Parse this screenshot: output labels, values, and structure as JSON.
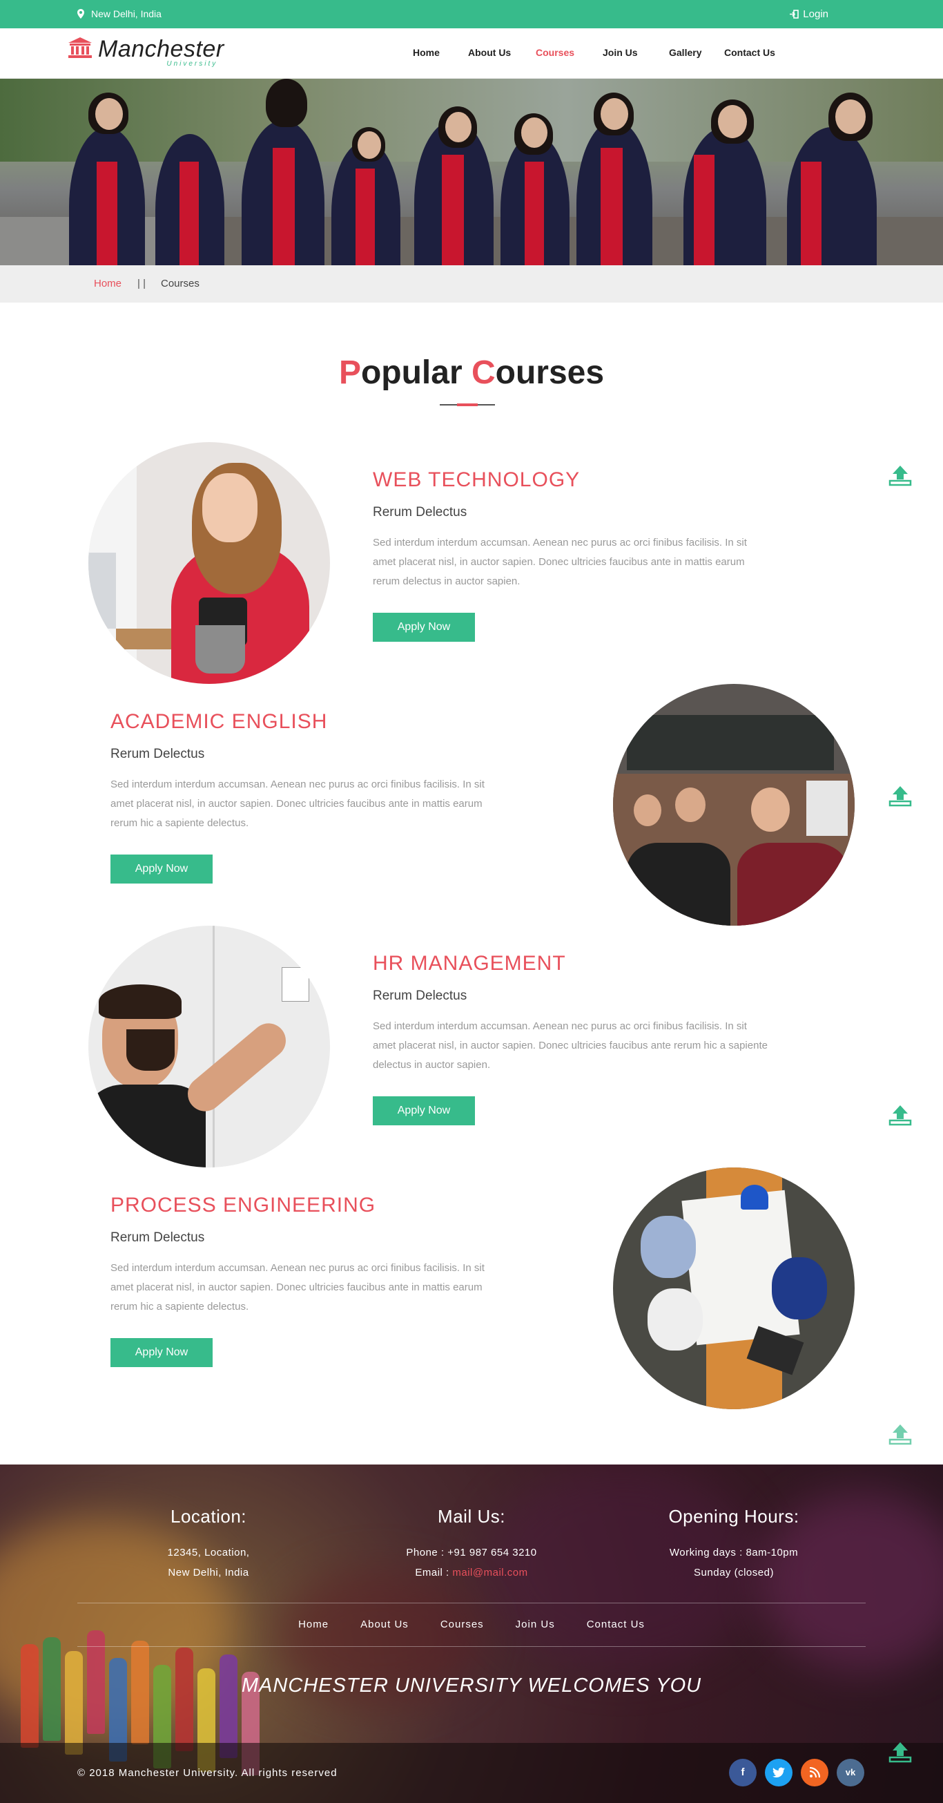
{
  "topbar": {
    "location": "New Delhi, India",
    "login": "Login"
  },
  "logo": {
    "title": "Manchester",
    "subtitle": "University"
  },
  "nav": [
    "Home",
    "About Us",
    "Courses",
    "Join Us",
    "Gallery",
    "Contact Us"
  ],
  "nav_active": "Courses",
  "breadcrumb": {
    "home": "Home",
    "separator": "| |",
    "current": "Courses"
  },
  "section": {
    "title_first_letter": "P",
    "title_rest1": "opular ",
    "title_second_letter": "C",
    "title_rest2": "ourses"
  },
  "courses": [
    {
      "title": "WEB TECHNOLOGY",
      "subtitle": "Rerum Delectus",
      "line1": "Sed interdum interdum accumsan. Aenean nec purus ac orci finibus facilisis. In sit",
      "line2": "amet placerat nisl, in auctor sapien. Donec ultricies faucibus ante in mattis earum",
      "line3": "rerum delectus in auctor sapien.",
      "button": "Apply Now"
    },
    {
      "title": "ACADEMIC ENGLISH",
      "subtitle": "Rerum Delectus",
      "line1": "Sed interdum interdum accumsan. Aenean nec purus ac orci finibus facilisis. In sit",
      "line2": "amet placerat nisl, in auctor sapien. Donec ultricies faucibus ante in mattis earum",
      "line3": "rerum hic a sapiente delectus.",
      "button": "Apply Now"
    },
    {
      "title": "HR MANAGEMENT",
      "subtitle": "Rerum Delectus",
      "line1": "Sed interdum interdum accumsan. Aenean nec purus ac orci finibus facilisis. In sit",
      "line2": "amet placerat nisl, in auctor sapien. Donec ultricies faucibus ante rerum hic a sapiente",
      "line3": "delectus in auctor sapien.",
      "button": "Apply Now"
    },
    {
      "title": "PROCESS ENGINEERING",
      "subtitle": "Rerum Delectus",
      "line1": "Sed interdum interdum accumsan. Aenean nec purus ac orci finibus facilisis. In sit",
      "line2": "amet placerat nisl, in auctor sapien. Donec ultricies faucibus ante in mattis earum",
      "line3": "rerum hic a sapiente delectus.",
      "button": "Apply Now"
    }
  ],
  "footer": {
    "location": {
      "heading": "Location:",
      "line1": "12345, Location,",
      "line2": "New Delhi, India"
    },
    "mail": {
      "heading": "Mail Us:",
      "phone": "Phone : +91 987 654 3210",
      "email_label": "Email : ",
      "email": "mail@mail.com"
    },
    "hours": {
      "heading": "Opening Hours:",
      "line1": "Working days : 8am-10pm",
      "line2": "Sunday (closed)"
    },
    "nav": [
      "Home",
      "About Us",
      "Courses",
      "Join Us",
      "Contact Us"
    ],
    "welcome": "MANCHESTER UNIVERSITY WELCOMES YOU",
    "copyright": "© 2018 Manchester University. All rights reserved",
    "social": [
      {
        "name": "facebook-icon",
        "glyph": "f",
        "color": "#3b5998"
      },
      {
        "name": "twitter-icon",
        "glyph": "t",
        "color": "#1da1f2"
      },
      {
        "name": "rss-icon",
        "glyph": "⌇",
        "color": "#f26522"
      },
      {
        "name": "vk-icon",
        "glyph": "vk",
        "color": "#4c6c91"
      }
    ]
  },
  "colors": {
    "accent": "#37bb8b",
    "brand_red": "#e8505b"
  },
  "icons": {
    "location": "map-marker-icon",
    "login": "sign-in-icon",
    "logo": "institution-icon",
    "scroll": "upload-icon"
  }
}
